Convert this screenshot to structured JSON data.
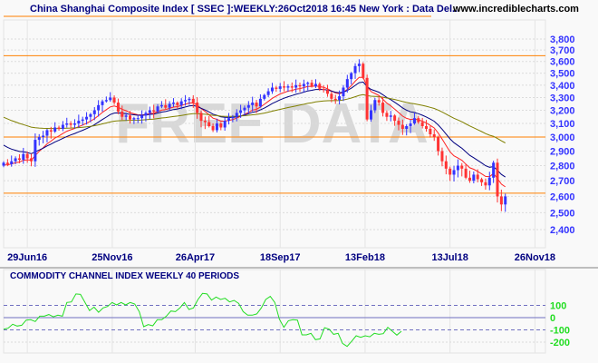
{
  "header": {
    "title": "China Shanghai Composite Index [ SSEC ]:WEEKLY:26Oct2018 16:45 New York : Data Del..",
    "site": "www.incrediblecharts.com"
  },
  "watermark": "FREE DATA",
  "colors": {
    "up": "#3333ff",
    "down": "#ff3333",
    "ema_fast": "#ff2222",
    "ema_mid": "#000080",
    "ema_slow": "#808000",
    "hline": "#ff8000",
    "axis_text": "#3333ff",
    "cci": "#22dd22",
    "title": "#000080"
  },
  "chart_data": [
    {
      "type": "candlestick",
      "title": "China Shanghai Composite Index [ SSEC ]:WEEKLY",
      "scale": "log",
      "ylim": [
        2330,
        3900
      ],
      "yticks": [
        "3,800",
        "3,700",
        "3,600",
        "3,500",
        "3,400",
        "3,300",
        "3,200",
        "3,100",
        "3,000",
        "2,900",
        "2,800",
        "2,700",
        "2,600",
        "2,500",
        "2,400"
      ],
      "ytick_values": [
        3800,
        3700,
        3600,
        3500,
        3400,
        3300,
        3200,
        3100,
        3000,
        2900,
        2800,
        2700,
        2600,
        2500,
        2400
      ],
      "xticks": [
        "29Jun16",
        "25Nov16",
        "26Apr17",
        "18Sep17",
        "13Feb18",
        "13Jul18",
        "26Nov18"
      ],
      "xtick_week_index": [
        6,
        27.5,
        48.5,
        70,
        91.5,
        113,
        134.5
      ],
      "horizontal_lines": [
        3650,
        3000,
        2620
      ],
      "moving_averages": [
        {
          "name": "fast",
          "period": 8,
          "seed": 2800
        },
        {
          "name": "mid",
          "period": 15,
          "seed": 2960
        },
        {
          "name": "slow",
          "period": 50,
          "seed": 3160
        }
      ],
      "first_open": 2800,
      "closes": [
        2820,
        2810,
        2830,
        2850,
        2840,
        2880,
        2850,
        2830,
        2980,
        3000,
        3010,
        3050,
        3040,
        3070,
        3060,
        3090,
        3100,
        3090,
        3100,
        3120,
        3130,
        3150,
        3170,
        3200,
        3240,
        3270,
        3280,
        3300,
        3260,
        3190,
        3150,
        3160,
        3130,
        3140,
        3140,
        3160,
        3180,
        3200,
        3190,
        3230,
        3240,
        3220,
        3250,
        3260,
        3240,
        3270,
        3280,
        3290,
        3260,
        3180,
        3120,
        3110,
        3080,
        3050,
        3100,
        3070,
        3120,
        3140,
        3150,
        3180,
        3200,
        3220,
        3240,
        3260,
        3230,
        3290,
        3320,
        3350,
        3380,
        3370,
        3390,
        3380,
        3390,
        3380,
        3400,
        3390,
        3410,
        3420,
        3390,
        3410,
        3370,
        3360,
        3330,
        3290,
        3280,
        3310,
        3380,
        3450,
        3500,
        3560,
        3580,
        3460,
        3130,
        3200,
        3280,
        3260,
        3180,
        3150,
        3160,
        3120,
        3090,
        3060,
        3080,
        3100,
        3140,
        3110,
        3080,
        3060,
        3020,
        3000,
        2900,
        2830,
        2780,
        2740,
        2770,
        2800,
        2780,
        2720,
        2700,
        2740,
        2710,
        2690,
        2670,
        2720,
        2820,
        2600,
        2550,
        2600
      ]
    },
    {
      "type": "line",
      "title": "COMMODITY CHANNEL INDEX WEEKLY 40 PERIODS",
      "ylim": [
        -260,
        240
      ],
      "yticks": [
        "100",
        "0",
        "-100",
        "-200"
      ],
      "ytick_values": [
        100,
        0,
        -100,
        -200
      ],
      "reference_lines": [
        100,
        0,
        -100
      ],
      "values": [
        -94,
        -86,
        -54,
        -69,
        -62,
        -20,
        -17,
        -32,
        12,
        12,
        25,
        7,
        20,
        12,
        124,
        128,
        193,
        190,
        124,
        57,
        86,
        44,
        79,
        91,
        124,
        104,
        124,
        104,
        124,
        111,
        49,
        -74,
        -57,
        -67,
        -17,
        -17,
        12,
        54,
        49,
        79,
        124,
        67,
        79,
        148,
        198,
        193,
        143,
        168,
        148,
        158,
        128,
        141,
        116,
        49,
        20,
        20,
        30,
        79,
        148,
        173,
        124,
        -12,
        -79,
        -25,
        -17,
        -20,
        -141,
        -141,
        -128,
        -180,
        -173,
        -82,
        -94,
        -136,
        -128,
        -210,
        -235,
        -193,
        -148,
        -161,
        -148,
        -156,
        -128,
        -136,
        -131,
        -79,
        -111,
        -143,
        -111
      ]
    }
  ]
}
